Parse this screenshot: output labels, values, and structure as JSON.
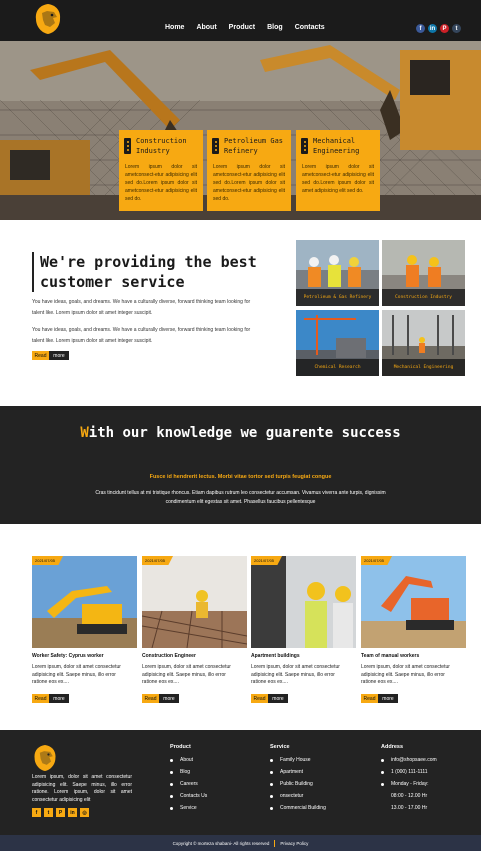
{
  "brand": {
    "accent": "#f7a912",
    "dark": "#232323",
    "logo_icon": "lion-head-icon"
  },
  "nav": {
    "items": [
      "Home",
      "About",
      "Product",
      "Blog",
      "Contacts"
    ]
  },
  "header_socials": [
    {
      "icon": "facebook-icon",
      "glyph": "f",
      "color": "#3b5998"
    },
    {
      "icon": "linkedin-icon",
      "glyph": "in",
      "color": "#0e76a8"
    },
    {
      "icon": "pinterest-icon",
      "glyph": "P",
      "color": "#cb2027"
    },
    {
      "icon": "tumblr-icon",
      "glyph": "t",
      "color": "#35465c"
    }
  ],
  "features": [
    {
      "title": "Construction Industry",
      "text": "Lorem ipsum dolor sit ametconsect-etur adipisicing elit sed do.Lorem ipsum dolor sit ametconsect-etur adipisicing elit sed do."
    },
    {
      "title": "Petrolieum Gas Refinery",
      "text": "Lorem ipsum dolor sit ametconsect-etur adipisicing elit sed do.Lorem ipsum dolor sit ametconsect-etur adipisicing elit sed do."
    },
    {
      "title": "Mechanical Engineering",
      "text": "Lorem ipsum dolor sit ametconsect-etur adipisicing elit sed do.Lorem ipsum dolor sit amet adipisicing elit sed do."
    }
  ],
  "about": {
    "title": "We're providing the best customer service",
    "p1": "You have ideas, goals, and dreams. We have a culturally diverse, forward thinking team looking for talent like. Lorem ipsum dolor sit amet integer suscipit.",
    "p2": "You have ideas, goals, and dreams. We have a culturally diverse, forward thinking team looking for talent like. Lorem ipsum dolor sit amet integer suscipit.",
    "btn_a": "Read",
    "btn_b": "more"
  },
  "tiles": [
    "Petrolieum & Gas Refinery",
    "Construction Industry",
    "Chemical Research",
    "Mechanical Engineering"
  ],
  "banner": {
    "title_first": "W",
    "title_rest": "ith our knowledge we guarente success",
    "sub": "Fusce id hendrerit lectus. Morbi vitae tortor sed turpis feugiat congue",
    "desc": "Cras tincidunt tellus at mi tristique rhoncus. Etiam dapibus rutrum leo consectetur accumsan. Vivamus viverra ante turpis, dignissim condimentum elit egestas sit amet. Phasellus faucibus pellentesque"
  },
  "posts": [
    {
      "date": "2021/07/05",
      "title": "Worker Safety: Cyprus worker",
      "text": "Lorem ipsum, dolor sit amet consectetur adipisicing elit. Saepe minus, illo error ratione eos ex....",
      "btn_a": "Read",
      "btn_b": "more"
    },
    {
      "date": "2021/07/05",
      "title": "Construction Engineer",
      "text": "Lorem ipsum, dolor sit amet consectetur adipisicing elit. Saepe minus, illo error ratione eos ex....",
      "btn_a": "Read",
      "btn_b": "more"
    },
    {
      "date": "2021/07/05",
      "title": "Apartment buildings",
      "text": "Lorem ipsum, dolor sit amet consectetur adipisicing elit. Saepe minus, illo error ratione eos ex....",
      "btn_a": "Read",
      "btn_b": "more"
    },
    {
      "date": "2021/07/05",
      "title": "Team of manual workers",
      "text": "Lorem ipsum, dolor sit amet consectetur adipisicing elit. Saepe minus, illo error ratione eos ex....",
      "btn_a": "Read",
      "btn_b": "more"
    }
  ],
  "footer": {
    "text": "Lorem ipsum, dolor sit amet consectetur adipisicing elit. Saepe minus, illo error ratione. Lorem ipsum, dolor sit amet consectetur adipisicing elit",
    "socials": [
      {
        "icon": "facebook-icon",
        "glyph": "f"
      },
      {
        "icon": "twitter-icon",
        "glyph": "t"
      },
      {
        "icon": "pinterest-icon",
        "glyph": "P"
      },
      {
        "icon": "linkedin-icon",
        "glyph": "in"
      },
      {
        "icon": "instagram-icon",
        "glyph": "◎"
      }
    ],
    "product": {
      "title": "Product",
      "items": [
        "About",
        "Blog",
        "Careers",
        "Contacts Us",
        "Service"
      ]
    },
    "service": {
      "title": "Service",
      "items": [
        "Family House",
        "Apartment",
        "Public Building",
        "onsectetur",
        "Commercial Building"
      ]
    },
    "address": {
      "title": "Address",
      "email": "info@shopsaee.com",
      "phone": "1 (000) 111-1111",
      "hours_label": "Monday - Friday:",
      "hours1": "08:00 - 12.00 Hr",
      "hours2": "13.00 - 17.00 Hr"
    }
  },
  "copyright": {
    "text": "Copyright © morteza shabani- All rights reserved",
    "link": "Privacy Policy"
  }
}
